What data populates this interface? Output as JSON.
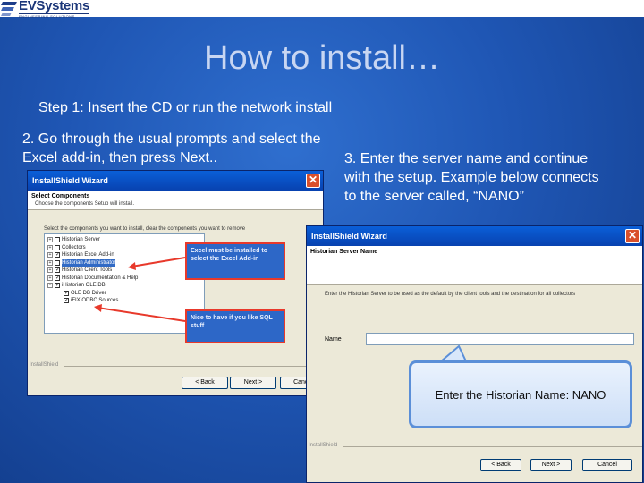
{
  "logo": {
    "name": "EVSystems",
    "tagline": "ENGINEERING SOLUTIONS"
  },
  "slide": {
    "title": "How to install…",
    "step1": "Step 1:  Insert the CD or run the network install",
    "step2": "2. Go through the usual prompts and select the Excel add-in, then press Next..",
    "step3": "3. Enter the server name and continue with the setup.  Example below connects to the server called, “NANO”"
  },
  "dialog1": {
    "title": "InstallShield Wizard",
    "close": "✕",
    "heading": "Select Components",
    "subheading": "Choose the components Setup will install.",
    "instruction": "Select the components you want to install, clear the components you want to remove",
    "tree": [
      {
        "label": "Historian Server",
        "checked": "",
        "expander": "+"
      },
      {
        "label": "Collectors",
        "checked": "",
        "expander": "+"
      },
      {
        "label": "Historian Excel Add-in",
        "checked": "✓",
        "expander": "+"
      },
      {
        "label": "Historian Administrator",
        "checked": "",
        "expander": "+"
      },
      {
        "label": "Historian Client Tools",
        "checked": "✓",
        "expander": "+"
      },
      {
        "label": "Historian Documentation & Help",
        "checked": "✓",
        "expander": "+"
      },
      {
        "label": "iHistorian OLE DB",
        "checked": "✓",
        "expander": "-"
      },
      {
        "label": "OLE DB Driver",
        "checked": "✓",
        "expander": ""
      },
      {
        "label": "iFIX ODBC Sources",
        "checked": "✓",
        "expander": ""
      }
    ],
    "callout1": "Excel must be installed to select the Excel Add-in",
    "callout2": "Nice to have if you like SQL stuff",
    "footer": "InstallShield",
    "back": "< Back",
    "next": "Next >",
    "cancel": "Cancel"
  },
  "dialog2": {
    "title": "InstallShield Wizard",
    "close": "✕",
    "heading": "Historian Server Name",
    "instruction": "Enter the Historian Server to be used as the default by the client tools and the destination for all collectors",
    "name_label": "Name",
    "name_value": "",
    "callout": "Enter the Historian Name: NANO",
    "footer": "InstallShield",
    "back": "< Back",
    "next": "Next >",
    "cancel": "Cancel"
  },
  "colors": {
    "background": "#1f56b4",
    "title": "#c8d6f2",
    "callout_border": "#e8392b"
  }
}
